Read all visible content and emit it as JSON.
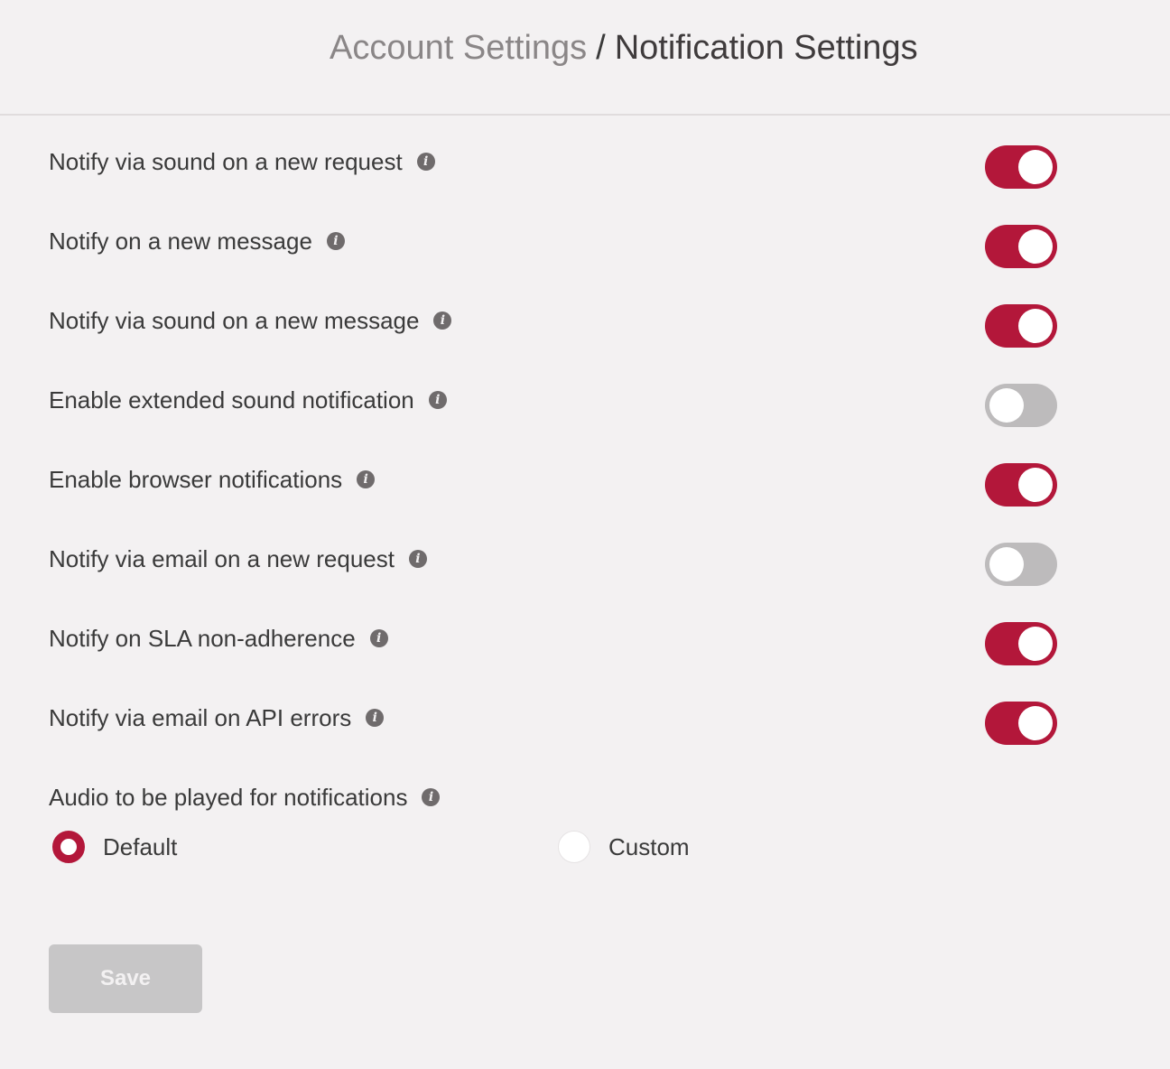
{
  "breadcrumb": {
    "parent": "Account Settings",
    "separator": "/",
    "current": "Notification Settings"
  },
  "settings": [
    {
      "label": "Notify via sound on a new request",
      "enabled": true
    },
    {
      "label": "Notify on a new message",
      "enabled": true
    },
    {
      "label": "Notify via sound on a new message",
      "enabled": true
    },
    {
      "label": "Enable extended sound notification",
      "enabled": false
    },
    {
      "label": "Enable browser notifications",
      "enabled": true
    },
    {
      "label": "Notify via email on a new request",
      "enabled": false
    },
    {
      "label": "Notify on SLA non-adherence",
      "enabled": true
    },
    {
      "label": "Notify via email on API errors",
      "enabled": true
    }
  ],
  "audio": {
    "label": "Audio to be played for notifications",
    "options": [
      {
        "label": "Default",
        "selected": true
      },
      {
        "label": "Custom",
        "selected": false
      }
    ]
  },
  "save_button": {
    "label": "Save",
    "disabled": true
  },
  "icons": {
    "info": "info-icon",
    "info_glyph": "i"
  },
  "colors": {
    "accent": "#b3173a",
    "toggle_off": "#bdbbbc",
    "background": "#f3f1f2",
    "button_disabled": "#c7c6c7"
  }
}
